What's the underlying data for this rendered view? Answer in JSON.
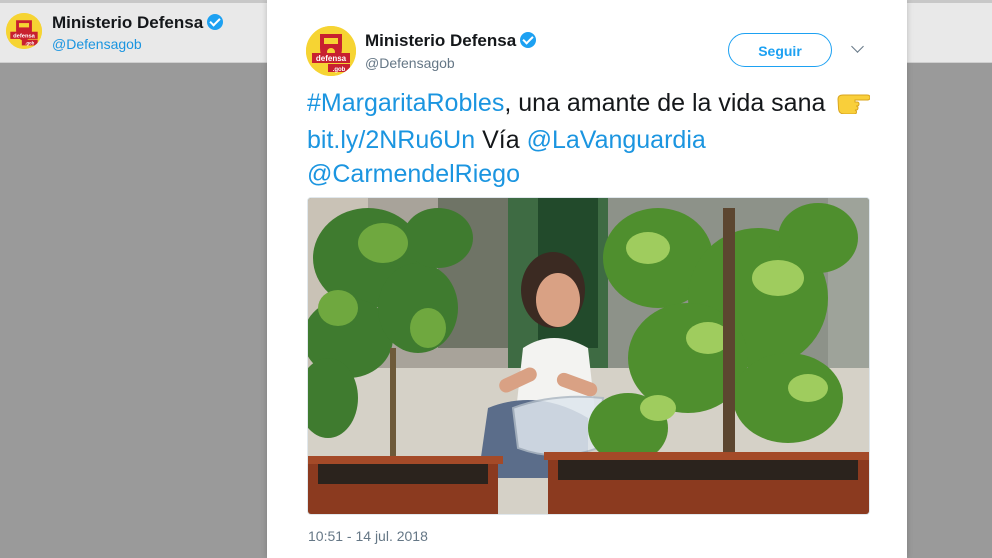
{
  "background_profile": {
    "name": "Ministerio Defensa",
    "handle": "@Defensagob"
  },
  "tweet": {
    "author_name": "Ministerio Defensa",
    "author_handle": "@Defensagob",
    "follow_label": "Seguir",
    "text_parts": {
      "hashtag": "#MargaritaRobles",
      "text1": ", una amante de la vida sana",
      "link": "bit.ly/2NRu6Un",
      "text2": " Vía ",
      "mention1": "@LaVanguardia",
      "mention2": "@CarmendelRiego"
    },
    "timestamp": "10:51 - 14 jul. 2018"
  },
  "logo": {
    "text1": "defensa",
    "text2": ".gob"
  },
  "icons": {
    "verified": "verified-badge-icon",
    "more": "chevron-down-icon",
    "emoji": "pointing-right-hand-icon"
  },
  "colors": {
    "accent": "#1da1f2",
    "link": "#1b95e0",
    "text": "#14171a",
    "secondary": "#657786"
  }
}
